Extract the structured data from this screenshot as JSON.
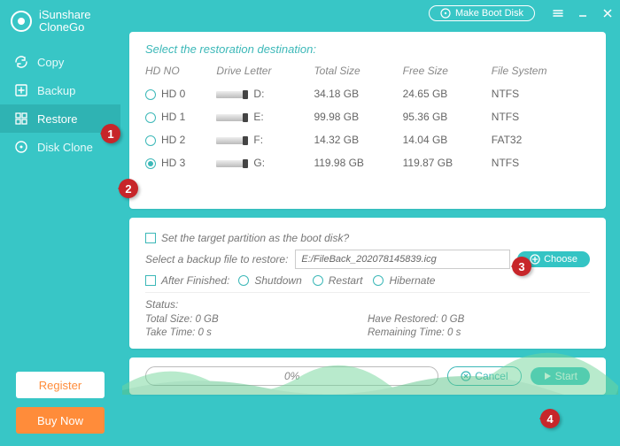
{
  "app": {
    "name1": "iSunshare",
    "name2": "CloneGo"
  },
  "winbar": {
    "makeBoot": "Make Boot Disk"
  },
  "nav": {
    "copy": "Copy",
    "backup": "Backup",
    "restore": "Restore",
    "diskclone": "Disk Clone"
  },
  "sidebarBtns": {
    "register": "Register",
    "buy": "Buy Now"
  },
  "top": {
    "title": "Select the restoration destination:",
    "cols": {
      "hdno": "HD NO",
      "drive": "Drive Letter",
      "total": "Total Size",
      "free": "Free Size",
      "fs": "File System"
    },
    "rows": [
      {
        "id": "HD 0",
        "letter": "D:",
        "total": "34.18 GB",
        "free": "24.65 GB",
        "fs": "NTFS",
        "selected": false
      },
      {
        "id": "HD 1",
        "letter": "E:",
        "total": "99.98 GB",
        "free": "95.36 GB",
        "fs": "NTFS",
        "selected": false
      },
      {
        "id": "HD 2",
        "letter": "F:",
        "total": "14.32 GB",
        "free": "14.04 GB",
        "fs": "FAT32",
        "selected": false
      },
      {
        "id": "HD 3",
        "letter": "G:",
        "total": "119.98 GB",
        "free": "119.87 GB",
        "fs": "NTFS",
        "selected": true
      }
    ]
  },
  "mid": {
    "bootChk": "Set the target partition as the boot disk?",
    "selectLabel": "Select a backup file to restore:",
    "path": "E:/FileBack_202078145839.icg",
    "choose": "Choose",
    "afterLabel": "After Finished:",
    "opts": {
      "shutdown": "Shutdown",
      "restart": "Restart",
      "hibernate": "Hibernate"
    },
    "status": {
      "header": "Status:",
      "totalSize": "Total Size: 0 GB",
      "restored": "Have Restored: 0 GB",
      "takeTime": "Take Time: 0 s",
      "remaining": "Remaining Time: 0 s"
    }
  },
  "bottom": {
    "progress": "0%",
    "cancel": "Cancel",
    "start": "Start"
  },
  "anno": {
    "a1": "1",
    "a2": "2",
    "a3": "3",
    "a4": "4"
  }
}
